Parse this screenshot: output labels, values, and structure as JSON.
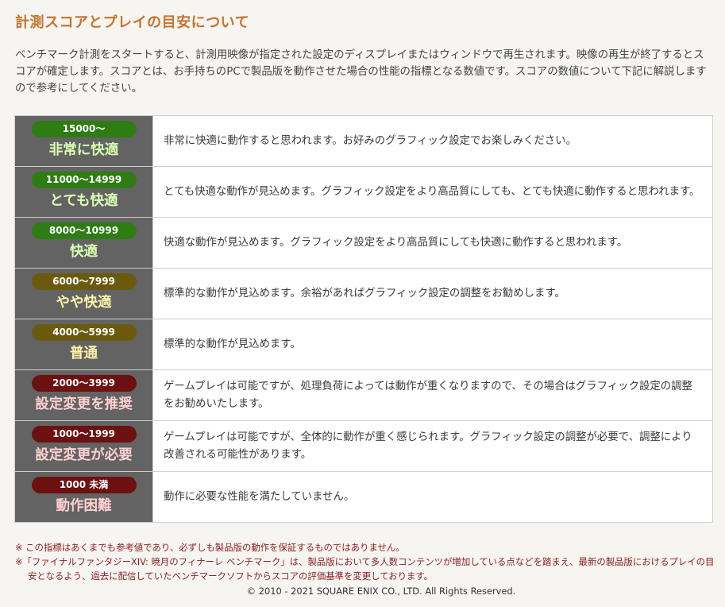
{
  "heading": "計測スコアとプレイの目安について",
  "intro": "ベンチマーク計測をスタートすると、計測用映像が指定された設定のディスプレイまたはウィンドウで再生されます。映像の再生が終了するとスコアが確定します。スコアとは、お手持ちのPCで製品版を動作させた場合の性能の指標となる数値です。スコアの数値について下記に解説しますので参考にしてください。",
  "ranks": [
    {
      "range": "15000～",
      "name": "非常に快適",
      "description": "非常に快適に動作すると思われます。お好みのグラフィック設定でお楽しみください。",
      "pill_color": "#2e7d13",
      "name_color": "#d9ffb0"
    },
    {
      "range": "11000～14999",
      "name": "とても快適",
      "description": "とても快適な動作が見込めます。グラフィック設定をより高品質にしても、とても快適に動作すると思われます。",
      "pill_color": "#2e7d13",
      "name_color": "#d9ffb0"
    },
    {
      "range": "8000～10999",
      "name": "快適",
      "description": "快適な動作が見込めます。グラフィック設定をより高品質にしても快適に動作すると思われます。",
      "pill_color": "#2e7d13",
      "name_color": "#d9ffb0"
    },
    {
      "range": "6000～7999",
      "name": "やや快適",
      "description": "標準的な動作が見込めます。余裕があればグラフィック設定の調整をお勧めします。",
      "pill_color": "#6b5a0e",
      "name_color": "#fff3a8"
    },
    {
      "range": "4000～5999",
      "name": "普通",
      "description": "標準的な動作が見込めます。",
      "pill_color": "#6b5a0e",
      "name_color": "#fff3a8"
    },
    {
      "range": "2000～3999",
      "name": "設定変更を推奨",
      "description": "ゲームプレイは可能ですが、処理負荷によっては動作が重くなりますので、その場合はグラフィック設定の調整をお勧めいたします。",
      "pill_color": "#6d1010",
      "name_color": "#ffd0d0"
    },
    {
      "range": "1000～1999",
      "name": "設定変更が必要",
      "description": "ゲームプレイは可能ですが、全体的に動作が重く感じられます。グラフィック設定の調整が必要で、調整により改善される可能性があります。",
      "pill_color": "#6d1010",
      "name_color": "#ffd0d0"
    },
    {
      "range": "1000 未満",
      "name": "動作困難",
      "description": "動作に必要な性能を満たしていません。",
      "pill_color": "#6d1010",
      "name_color": "#ffd0d0"
    }
  ],
  "notes": [
    "※ この指標はあくまでも参考値であり、必ずしも製品版の動作を保証するものではありません。",
    "※「ファイナルファンタジーXIV: 暁月のフィナーレ ベンチマーク」は、製品版において多人数コンテンツが増加している点などを踏まえ、最新の製品版におけるプレイの目安となるよう、過去に配信していたベンチマークソフトからスコアの評価基準を変更しております。"
  ],
  "copyright": "© 2010 - 2021 SQUARE ENIX CO., LTD. All Rights Reserved."
}
